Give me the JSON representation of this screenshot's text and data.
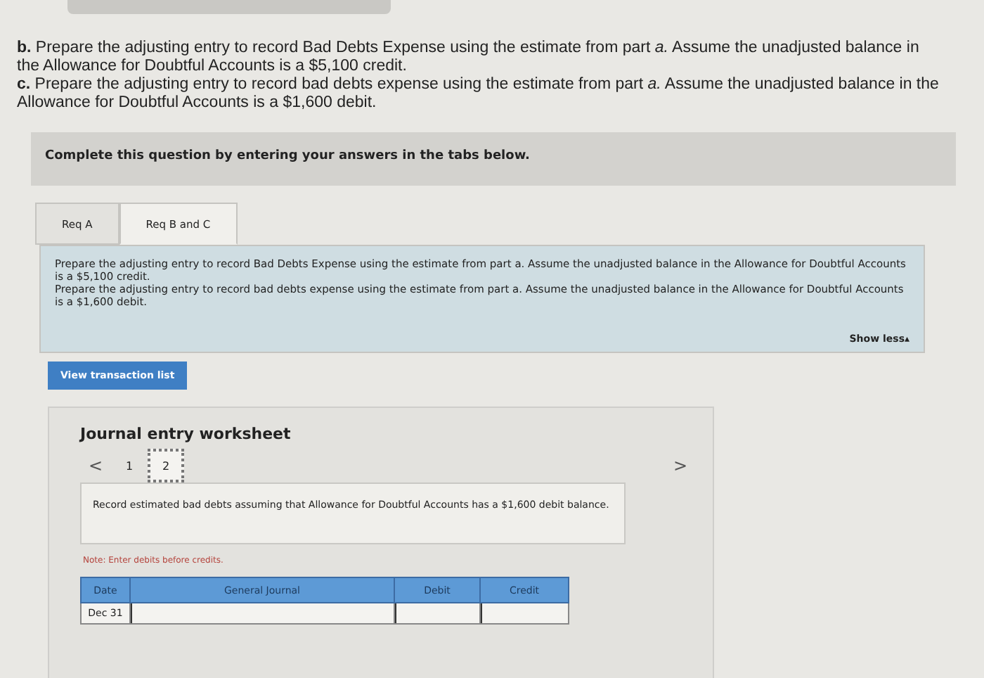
{
  "intro": [
    "**b.** Prepare the adjusting entry to record Bad Debts Expense using the estimate from part *a.* Assume the unadjusted balance in the Allowance for Doubtful Accounts is a $5,100 credit.",
    "**c.** Prepare the adjusting entry to record bad debts expense using the estimate from part *a.* Assume the unadjusted balance in the Allowance for Doubtful Accounts is a $1,600 debit."
  ],
  "instruction": "Complete this question by entering your answers in the tabs below.",
  "tabs": [
    {
      "label": "Req A",
      "selected": false
    },
    {
      "label": "Req B and C",
      "selected": true
    }
  ],
  "tab_panel": {
    "paragraphs": [
      "Prepare the adjusting entry to record Bad Debts Expense using the estimate from part a. Assume the unadjusted balance in the Allowance for Doubtful Accounts is a $5,100 credit.",
      "Prepare the adjusting entry to record bad debts expense using the estimate from part a. Assume the unadjusted balance in the Allowance for Doubtful Accounts is a $1,600 debit."
    ],
    "toggle": "Show less",
    "toggle_icon": "▴"
  },
  "view_button": "View transaction list",
  "worksheet": {
    "title": "Journal entry worksheet",
    "prev": "<",
    "next": ">",
    "steps": [
      {
        "label": "1",
        "selected": false
      },
      {
        "label": "2",
        "selected": true
      }
    ],
    "description": "Record estimated bad debts assuming that Allowance for Doubtful Accounts has a $1,600 debit balance.",
    "note": "Note: Enter debits before credits.",
    "table": {
      "columns": [
        "Date",
        "General Journal",
        "Debit",
        "Credit"
      ],
      "rows": [
        {
          "date": "Dec 31"
        }
      ]
    }
  }
}
